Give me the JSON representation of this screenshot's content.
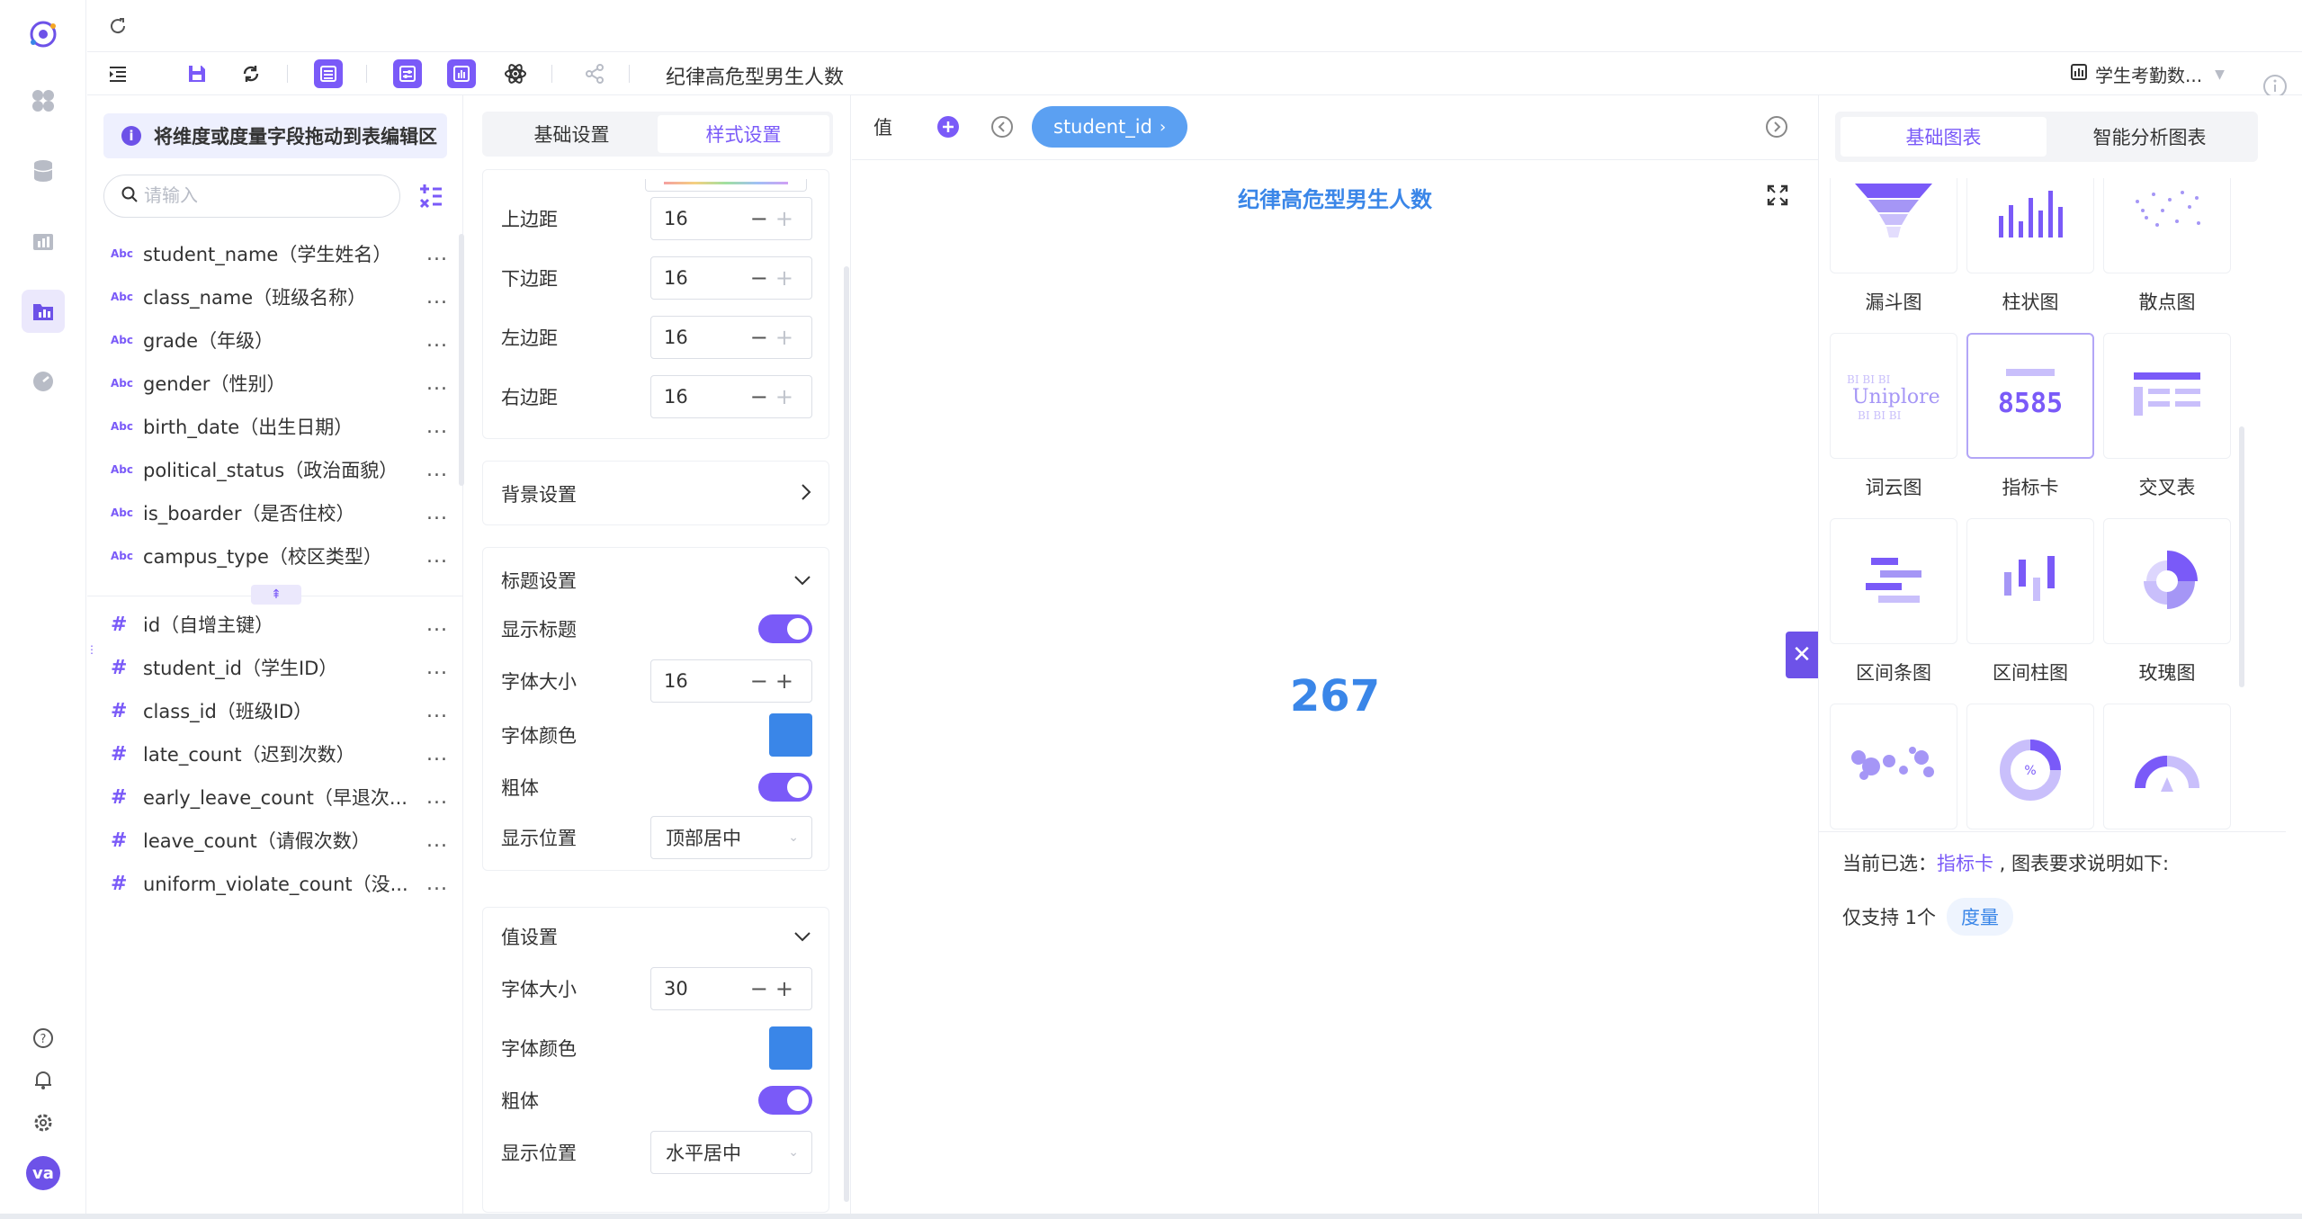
{
  "toolbar": {
    "title": "纪律高危型男生人数",
    "dataset": "学生考勤数..."
  },
  "field_panel": {
    "hint": "将维度或度量字段拖动到表编辑区",
    "hint_icon": "info-icon",
    "search_placeholder": "请输入",
    "dimension_type": "Abc",
    "dimensions": [
      "student_name（学生姓名）",
      "class_name（班级名称）",
      "grade（年级）",
      "gender（性别）",
      "birth_date（出生日期）",
      "political_status（政治面貌）",
      "is_boarder（是否住校）",
      "campus_type（校区类型）"
    ],
    "measures": [
      "id（自增主键）",
      "student_id（学生ID）",
      "class_id（班级ID）",
      "late_count（迟到次数）",
      "early_leave_count（早退次...",
      "leave_count（请假次数）",
      "uniform_violate_count（没..."
    ],
    "more": "...",
    "measure_type": "#"
  },
  "settings": {
    "tabs": [
      "基础设置",
      "样式设置"
    ],
    "active_tab": 1,
    "margins": [
      {
        "label": "上边距",
        "value": "16"
      },
      {
        "label": "下边距",
        "value": "16"
      },
      {
        "label": "左边距",
        "value": "16"
      },
      {
        "label": "右边距",
        "value": "16"
      }
    ],
    "background": "背景设置",
    "title_section": {
      "header": "标题设置",
      "show_title": "显示标题",
      "font_size_label": "字体大小",
      "font_size": "16",
      "font_color_label": "字体颜色",
      "font_color": "#3a86e8",
      "bold_label": "粗体",
      "position_label": "显示位置",
      "position": "顶部居中"
    },
    "value_section": {
      "header": "值设置",
      "font_size_label": "字体大小",
      "font_size": "30",
      "font_color_label": "字体颜色",
      "font_color": "#3a86e8",
      "bold_label": "粗体",
      "position_label": "显示位置",
      "position": "水平居中"
    }
  },
  "canvas": {
    "value_label": "值",
    "pill": "student_id",
    "chart_title": "纪律高危型男生人数",
    "kpi_value": "267",
    "accent": "#3a86e8"
  },
  "chart_panel": {
    "tabs": [
      "基础图表",
      "智能分析图表"
    ],
    "active_tab": 0,
    "charts": [
      "漏斗图",
      "柱状图",
      "散点图",
      "词云图",
      "指标卡",
      "交叉表",
      "区间条图",
      "区间柱图",
      "玫瑰图",
      "",
      "",
      ""
    ],
    "selected": "指标卡",
    "wordcloud_text": "Uniplore",
    "wordcloud_small": "BI BI BI",
    "kpi_preview": "8585",
    "percent_sign": "%",
    "current_prefix": "当前已选：",
    "current_suffix": " , 图表要求说明如下:",
    "requirement_text": "仅支持 1个",
    "requirement_tag": "度量"
  },
  "user": {
    "avatar": "va"
  },
  "colors": {
    "brand": "#7a5af8",
    "accent_blue": "#3a86e8"
  }
}
